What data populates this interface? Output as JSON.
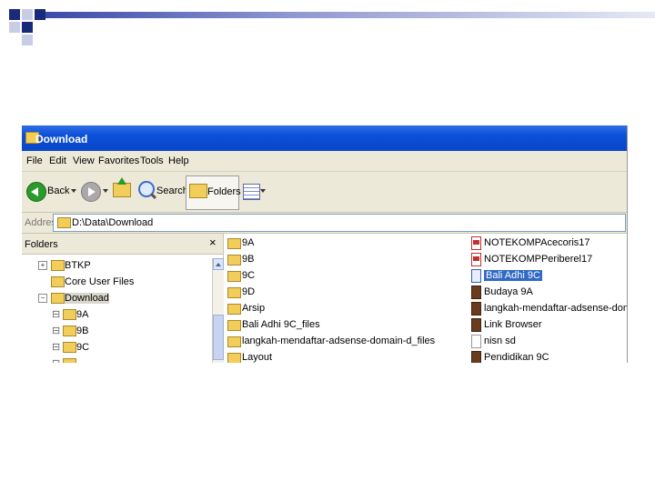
{
  "colors": {
    "titlebar": "#0b4fd8",
    "selection": "#316ac5",
    "folder": "#f2cd5a"
  },
  "window": {
    "title": "Download"
  },
  "menu": [
    "File",
    "Edit",
    "View",
    "Favorites",
    "Tools",
    "Help"
  ],
  "toolbar": {
    "back_label": "Back",
    "search_label": "Search",
    "folders_label": "Folders"
  },
  "address": {
    "label": "Address",
    "value": "D:\\Data\\Download"
  },
  "folders_pane": {
    "title": "Folders",
    "close_glyph": "×",
    "tree": [
      {
        "expander": "+",
        "label": "BTKP"
      },
      {
        "expander": "",
        "label": "Core User Files"
      },
      {
        "expander": "−",
        "label": "Download"
      },
      {
        "expander": "",
        "label": "9A"
      },
      {
        "expander": "",
        "label": "9B"
      },
      {
        "expander": "",
        "label": "9C"
      }
    ]
  },
  "files_col1": [
    {
      "icon": "folder-icon",
      "label": "9A"
    },
    {
      "icon": "folder-icon",
      "label": "9B"
    },
    {
      "icon": "folder-icon",
      "label": "9C"
    },
    {
      "icon": "folder-icon",
      "label": "9D"
    },
    {
      "icon": "folder-icon",
      "label": "Arsip"
    },
    {
      "icon": "folder-icon",
      "label": "Bali Adhi 9C_files"
    },
    {
      "icon": "folder-icon",
      "label": "langkah-mendaftar-adsense-domain-d_files"
    },
    {
      "icon": "folder-icon",
      "label": "Layout"
    }
  ],
  "files_col2": [
    {
      "icon": "pdf-icon",
      "label": "NOTEKOMPAcecoris17",
      "selected": false
    },
    {
      "icon": "pdf-icon",
      "label": "NOTEKOMPPeriberel17",
      "selected": false
    },
    {
      "icon": "web-page-icon",
      "label": "Bali Adhi 9C",
      "selected": true
    },
    {
      "icon": "app-icon",
      "label": "Budaya 9A",
      "selected": false
    },
    {
      "icon": "app-icon",
      "label": "langkah-mendaftar-adsense-domain-di",
      "selected": false
    },
    {
      "icon": "app-icon",
      "label": "Link Browser",
      "selected": false
    },
    {
      "icon": "file-icon",
      "label": "nisn sd",
      "selected": false
    },
    {
      "icon": "app-icon",
      "label": "Pendidikan 9C",
      "selected": false
    }
  ]
}
